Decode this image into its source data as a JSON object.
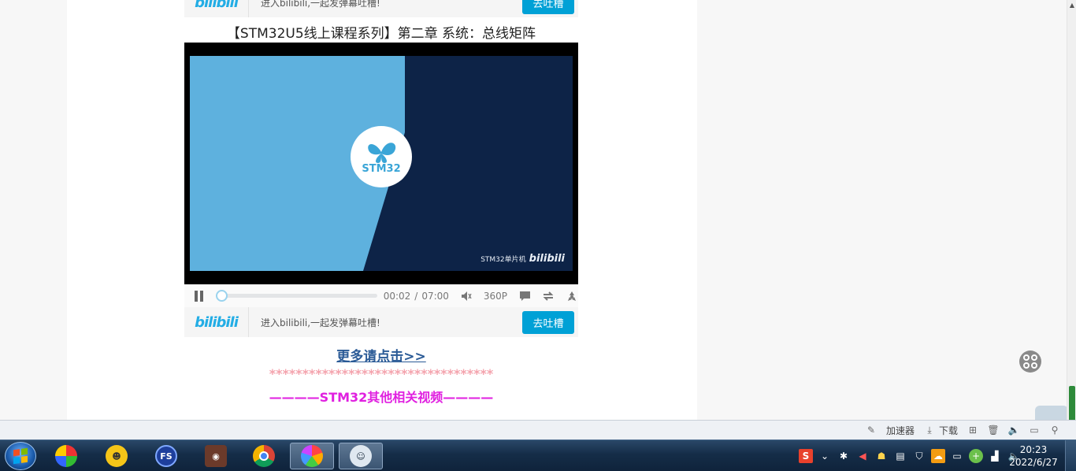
{
  "top_danmaku": {
    "logo": "bilibili",
    "hint": "进入bilibili,一起发弹幕吐槽!",
    "send_label": "去吐槽"
  },
  "video": {
    "title": "【STM32U5线上课程系列】第二章 系统：总线矩阵",
    "badge_text": "STM32",
    "watermark_text": "STM32单片机",
    "watermark_logo": "bilibili"
  },
  "controls": {
    "current_time": "00:02",
    "separator": "/",
    "duration": "07:00",
    "quality": "360P",
    "progress_fraction": 0.005
  },
  "bottom_danmaku": {
    "logo": "bilibili",
    "hint": "进入bilibili,一起发弹幕吐槽!",
    "send_label": "去吐槽"
  },
  "more_link": "更多请点击>>",
  "stars": "**********************************",
  "section_heading": "————STM32其他相关视频————",
  "statusbar": {
    "accelerator": "加速器",
    "download": "下载"
  },
  "taskbar": {
    "time": "20:23",
    "date": "2022/6/27"
  },
  "colors": {
    "bili_blue": "#00a1d6",
    "link": "#2a5a96",
    "heading_magenta": "#e020e0",
    "stars_pink": "#f4a3ad"
  }
}
